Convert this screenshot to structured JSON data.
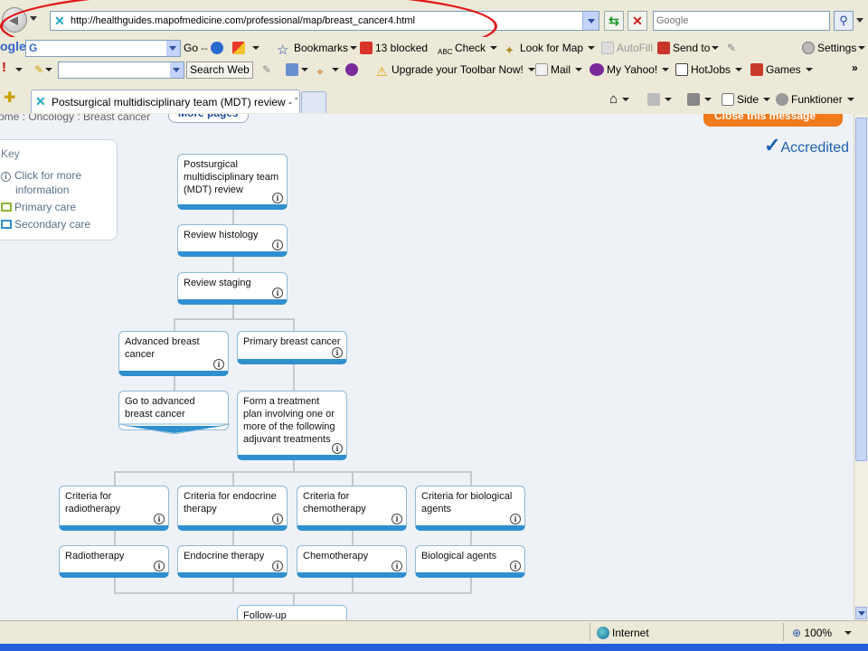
{
  "address_bar": {
    "url": "http://healthguides.mapofmedicine.com/professional/map/breast_cancer4.html",
    "search_placeholder": "Google"
  },
  "google_toolbar": {
    "logo": "ogle",
    "go_label": "Go",
    "bookmarks_label": "Bookmarks",
    "blocked_label": "13 blocked",
    "check_label": "Check",
    "look_for_map_label": "Look for Map",
    "autofill_label": "AutoFill",
    "send_to_label": "Send to",
    "settings_label": "Settings"
  },
  "yahoo_toolbar": {
    "logo": "!",
    "search_web_label": "Search Web",
    "upgrade_label": "Upgrade your Toolbar Now!",
    "mail_label": "Mail",
    "my_yahoo_label": "My Yahoo!",
    "hotjobs_label": "HotJobs",
    "games_label": "Games",
    "more_label": "»"
  },
  "tabs": {
    "active_title": "Postsurgical multidisciplinary team (MDT) review - The ..."
  },
  "command_bar": {
    "side_label": "Side",
    "funktioner_label": "Funktioner"
  },
  "page": {
    "breadcrumb": "ome : Oncology : Breast cancer",
    "more_pages": "More pages",
    "close_message": "Close this message",
    "accredited": "Accredited",
    "key": {
      "title": "Key",
      "click_more": "Click for more information",
      "click_more_1": "Click for more",
      "click_more_2": "information",
      "primary_care": "Primary care",
      "secondary_care": "Secondary care"
    },
    "nodes": {
      "mdt_review": "Postsurgical multidisciplinary team (MDT) review",
      "review_histology": "Review histology",
      "review_staging": "Review staging",
      "advanced": "Advanced breast cancer",
      "primary": "Primary breast cancer",
      "goto_advanced": "Go to advanced breast cancer",
      "treatment_plan": "Form a treatment plan involving one or more of the following adjuvant treatments",
      "crit_radio": "Criteria for radiotherapy",
      "crit_endo": "Criteria for endocrine therapy",
      "crit_chemo": "Criteria for chemotherapy",
      "crit_bio": "Criteria for biological agents",
      "radio": "Radiotherapy",
      "endo": "Endocrine therapy",
      "chemo": "Chemotherapy",
      "bio": "Biological agents",
      "followup": "Follow-up"
    }
  },
  "status_bar": {
    "zone": "Internet",
    "zoom": "100%"
  },
  "colors": {
    "highlight_oval": "#e01818",
    "node_accent": "#2f8fcf",
    "accredited": "#1d5fb0",
    "close_button": "#f07a1c"
  }
}
